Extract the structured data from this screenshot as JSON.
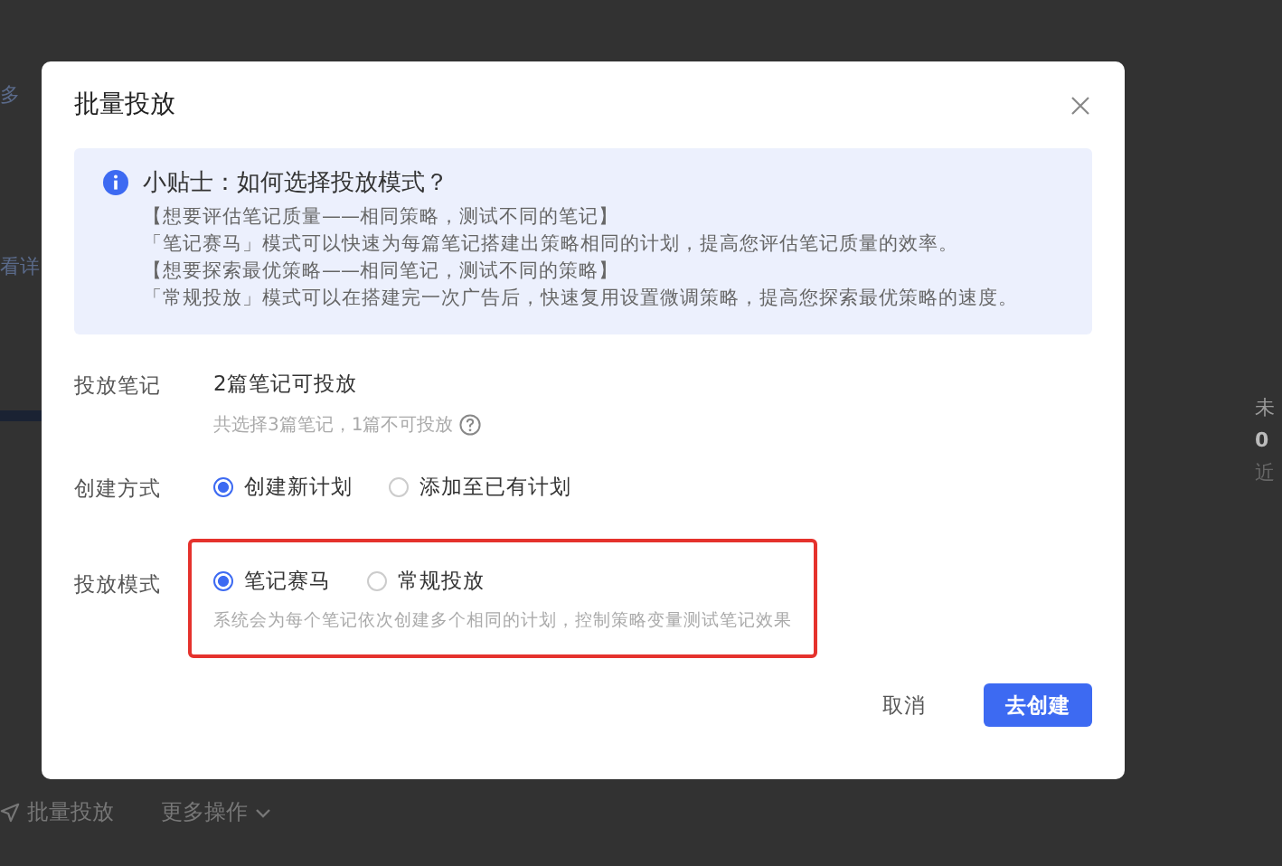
{
  "background": {
    "left_texts": [
      "多",
      "看详"
    ],
    "right_texts": [
      "未",
      "0",
      "近"
    ],
    "toolbar": [
      {
        "kind": "icon-button",
        "label": "批量投放"
      },
      {
        "kind": "dropdown",
        "label": "更多操作"
      }
    ]
  },
  "dialog": {
    "title": "批量投放",
    "tip": {
      "title": "小贴士：如何选择投放模式？",
      "lines": [
        "【想要评估笔记质量——相同策略，测试不同的笔记】",
        "「笔记赛马」模式可以快速为每篇笔记搭建出策略相同的计划，提高您评估笔记质量的效率。",
        "【想要探索最优策略——相同笔记，测试不同的策略】",
        "「常规投放」模式可以在搭建完一次广告后，快速复用设置微调策略，提高您探索最优策略的速度。"
      ]
    },
    "fields": [
      {
        "kind": "text",
        "label": "投放笔记",
        "value": "2篇笔记可投放",
        "hint": "共选择3篇笔记，1篇不可投放",
        "help": true,
        "highlighted": false
      },
      {
        "kind": "radio",
        "label": "创建方式",
        "options": [
          {
            "label": "创建新计划",
            "selected": true
          },
          {
            "label": "添加至已有计划",
            "selected": false
          }
        ],
        "highlighted": false
      },
      {
        "kind": "radio",
        "label": "投放模式",
        "options": [
          {
            "label": "笔记赛马",
            "selected": true
          },
          {
            "label": "常规投放",
            "selected": false
          }
        ],
        "hint": "系统会为每个笔记依次创建多个相同的计划，控制策略变量测试笔记效果",
        "highlighted": true
      }
    ],
    "buttons": [
      {
        "kind": "secondary",
        "label": "取消"
      },
      {
        "kind": "primary",
        "label": "去创建"
      }
    ]
  }
}
